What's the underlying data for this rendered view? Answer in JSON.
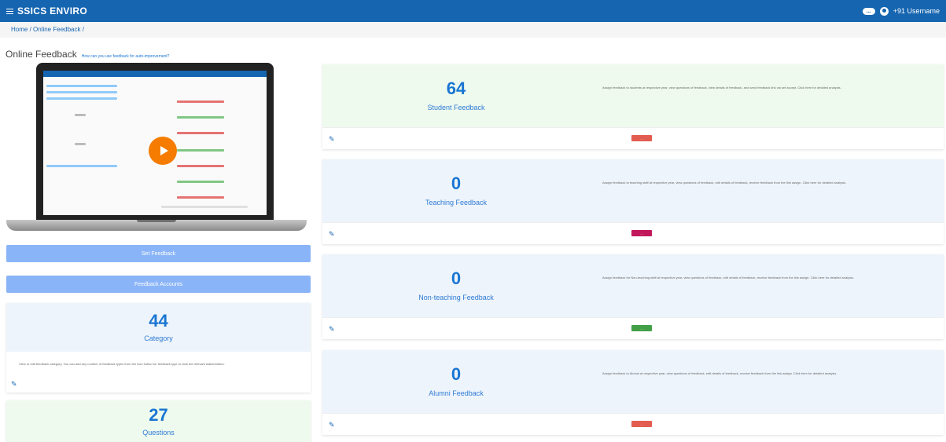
{
  "header": {
    "brand": "SSICS ENVIRO",
    "badge": "...",
    "user": "+91 Username"
  },
  "breadcrumb": "Home / Online Feedback /",
  "page": {
    "title": "Online Feedback",
    "subtitle_link": "How can you use feedback for auto-improvement?"
  },
  "buttons": {
    "set_feedback": "Set Feedback",
    "feedback_accounts": "Feedback Accounts"
  },
  "category_card": {
    "count": "44",
    "label": "Category",
    "description": "View or edit feedback category. You can add any number of feedback types from the icon button for feedback type to rank the relevant stakeholders."
  },
  "questions_card": {
    "count": "27",
    "label": "Questions"
  },
  "feedback_cards": [
    {
      "count": "64",
      "label": "Student Feedback",
      "description": "Assign feedback to students at respective year, view questions of feedback, view details of feedback, and send feedback link via set accept. Click here for detailed analysis.",
      "badge": "...",
      "badge_color": "#e25d4f",
      "bg": "#eefaee"
    },
    {
      "count": "0",
      "label": "Teaching Feedback",
      "description": "Assign feedback to teaching staff at respective year, view questions of feedback, edit details of feedback, receive feedback from the link assign. Click here for detailed analysis.",
      "badge": "...",
      "badge_color": "#c2185b",
      "bg": "#eef4fb"
    },
    {
      "count": "0",
      "label": "Non-teaching Feedback",
      "description": "Assign feedback for Non-teaching staff at respective year, view questions of feedback, edit details of feedback, receive feedback from the link assign. Click here for detailed analysis.",
      "badge": "...",
      "badge_color": "#43a047",
      "bg": "#eef4fb"
    },
    {
      "count": "0",
      "label": "Alumni Feedback",
      "description": "Assign feedback to Alumni at respective year, view questions of feedback, edit details of feedback, receive feedback from the link assign. Click here for detailed analysis.",
      "badge": "...",
      "badge_color": "#e25d4f",
      "bg": "#eef4fb"
    }
  ]
}
